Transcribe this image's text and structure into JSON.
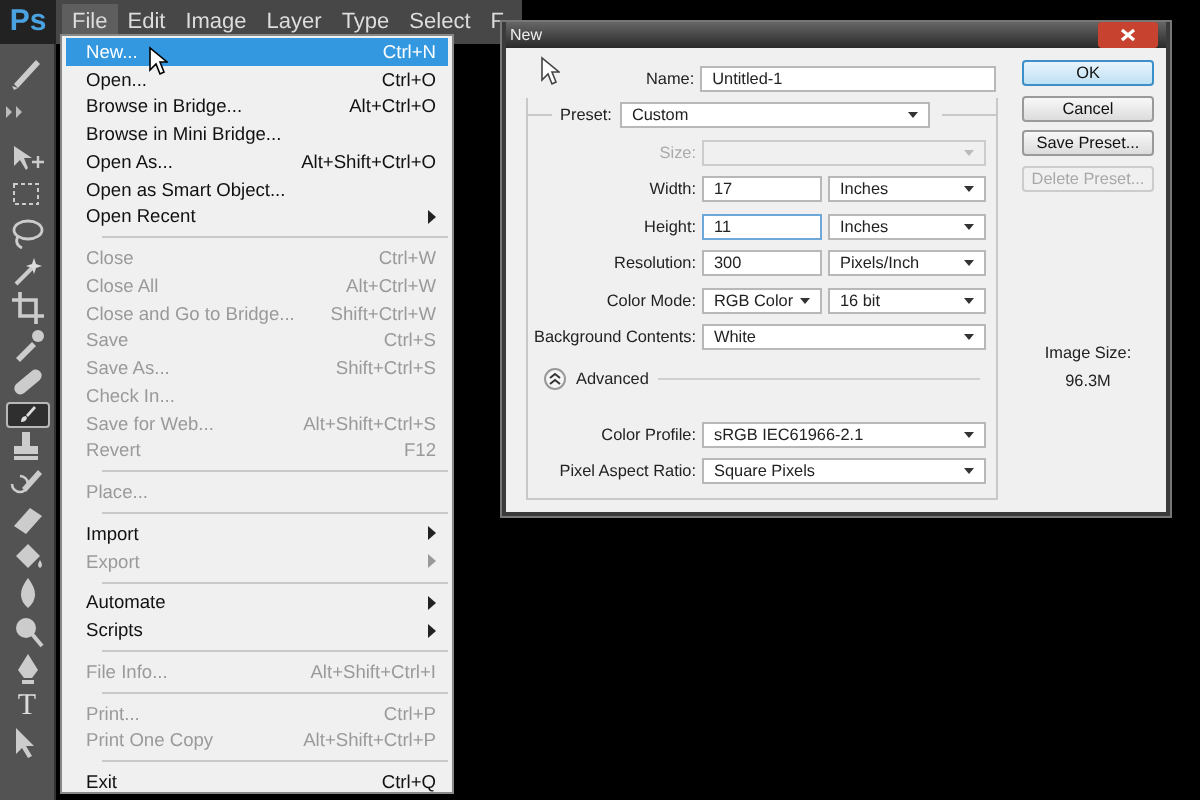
{
  "app": {
    "logo": "Ps"
  },
  "menubar": [
    {
      "label": "File",
      "selected": true
    },
    {
      "label": "Edit",
      "selected": false
    },
    {
      "label": "Image",
      "selected": false
    },
    {
      "label": "Layer",
      "selected": false
    },
    {
      "label": "Type",
      "selected": false
    },
    {
      "label": "Select",
      "selected": false
    },
    {
      "label": "F",
      "selected": false
    }
  ],
  "tools": [
    {
      "kind": "preset",
      "selected": false
    },
    {
      "kind": "move",
      "selected": false
    },
    {
      "kind": "marquee",
      "selected": false
    },
    {
      "kind": "lasso",
      "selected": false
    },
    {
      "kind": "wand",
      "selected": false
    },
    {
      "kind": "crop",
      "selected": false
    },
    {
      "kind": "eyedropper",
      "selected": false
    },
    {
      "kind": "bandage",
      "selected": false
    },
    {
      "kind": "brush",
      "selected": true
    },
    {
      "kind": "stamp",
      "selected": false
    },
    {
      "kind": "history",
      "selected": false
    },
    {
      "kind": "eraser",
      "selected": false
    },
    {
      "kind": "bucket",
      "selected": false
    },
    {
      "kind": "blur",
      "selected": false
    },
    {
      "kind": "dodge",
      "selected": false
    },
    {
      "kind": "pen",
      "selected": false
    },
    {
      "kind": "type",
      "selected": false,
      "label": "T"
    },
    {
      "kind": "path",
      "selected": false
    }
  ],
  "file_menu": [
    [
      {
        "label": "New...",
        "shortcut": "Ctrl+N",
        "disabled": false,
        "submenu": false,
        "selected": true
      },
      {
        "label": "Open...",
        "shortcut": "Ctrl+O",
        "disabled": false,
        "submenu": false,
        "selected": false
      },
      {
        "label": "Browse in Bridge...",
        "shortcut": "Alt+Ctrl+O",
        "disabled": false,
        "submenu": false,
        "selected": false
      },
      {
        "label": "Browse in Mini Bridge...",
        "disabled": false,
        "submenu": false,
        "selected": false
      },
      {
        "label": "Open As...",
        "shortcut": "Alt+Shift+Ctrl+O",
        "disabled": false,
        "submenu": false,
        "selected": false
      },
      {
        "label": "Open as Smart Object...",
        "disabled": false,
        "submenu": false,
        "selected": false
      },
      {
        "label": "Open Recent",
        "disabled": false,
        "submenu": true,
        "selected": false
      }
    ],
    [
      {
        "label": "Close",
        "shortcut": "Ctrl+W",
        "disabled": true,
        "submenu": false,
        "selected": false
      },
      {
        "label": "Close All",
        "shortcut": "Alt+Ctrl+W",
        "disabled": true,
        "submenu": false,
        "selected": false
      },
      {
        "label": "Close and Go to Bridge...",
        "shortcut": "Shift+Ctrl+W",
        "disabled": true,
        "submenu": false,
        "selected": false
      },
      {
        "label": "Save",
        "shortcut": "Ctrl+S",
        "disabled": true,
        "submenu": false,
        "selected": false
      },
      {
        "label": "Save As...",
        "shortcut": "Shift+Ctrl+S",
        "disabled": true,
        "submenu": false,
        "selected": false
      },
      {
        "label": "Check In...",
        "disabled": true,
        "submenu": false,
        "selected": false
      },
      {
        "label": "Save for Web...",
        "shortcut": "Alt+Shift+Ctrl+S",
        "disabled": true,
        "submenu": false,
        "selected": false
      },
      {
        "label": "Revert",
        "shortcut": "F12",
        "disabled": true,
        "submenu": false,
        "selected": false
      }
    ],
    [
      {
        "label": "Place...",
        "disabled": true,
        "submenu": false,
        "selected": false
      }
    ],
    [
      {
        "label": "Import",
        "disabled": false,
        "submenu": true,
        "selected": false
      },
      {
        "label": "Export",
        "disabled": true,
        "submenu": true,
        "selected": false
      }
    ],
    [
      {
        "label": "Automate",
        "disabled": false,
        "submenu": true,
        "selected": false
      },
      {
        "label": "Scripts",
        "disabled": false,
        "submenu": true,
        "selected": false
      }
    ],
    [
      {
        "label": "File Info...",
        "shortcut": "Alt+Shift+Ctrl+I",
        "disabled": true,
        "submenu": false,
        "selected": false
      }
    ],
    [
      {
        "label": "Print...",
        "shortcut": "Ctrl+P",
        "disabled": true,
        "submenu": false,
        "selected": false
      },
      {
        "label": "Print One Copy",
        "shortcut": "Alt+Shift+Ctrl+P",
        "disabled": true,
        "submenu": false,
        "selected": false
      }
    ],
    [
      {
        "label": "Exit",
        "shortcut": "Ctrl+Q",
        "disabled": false,
        "submenu": false,
        "selected": false
      }
    ]
  ],
  "dialog": {
    "title": "New",
    "name_field": {
      "label": "Name:",
      "value": "Untitled-1",
      "focused": false
    },
    "preset": {
      "label": "Preset:",
      "value": "Custom"
    },
    "fields": [
      {
        "kind": "select",
        "label": "Size:",
        "disabled": true
      },
      {
        "kind": "number",
        "label": "Width:",
        "value": "17",
        "unit": "Inches",
        "focused": false
      },
      {
        "kind": "number",
        "label": "Height:",
        "value": "11",
        "unit": "Inches",
        "focused": true
      },
      {
        "kind": "number",
        "label": "Resolution:",
        "value": "300",
        "unit": "Pixels/Inch",
        "focused": false
      },
      {
        "kind": "pair",
        "label": "Color Mode:",
        "value": "RGB Color",
        "unit": "16 bit"
      },
      {
        "kind": "select",
        "label": "Background Contents:",
        "value": "White",
        "disabled": false
      }
    ],
    "advanced": {
      "label": "Advanced",
      "expanded": true,
      "fields": [
        {
          "kind": "select",
          "label": "Color Profile:",
          "value": "sRGB IEC61966-2.1",
          "disabled": false
        },
        {
          "kind": "select",
          "label": "Pixel Aspect Ratio:",
          "value": "Square Pixels",
          "disabled": false
        }
      ]
    },
    "buttons": [
      {
        "label": "OK",
        "default": true,
        "disabled": false
      },
      {
        "label": "Cancel",
        "default": false,
        "disabled": false
      },
      {
        "label": "Save Preset...",
        "default": false,
        "disabled": false
      },
      {
        "label": "Delete Preset...",
        "default": false,
        "disabled": true
      }
    ],
    "image_size": {
      "label": "Image Size:",
      "value": "96.3M"
    }
  }
}
